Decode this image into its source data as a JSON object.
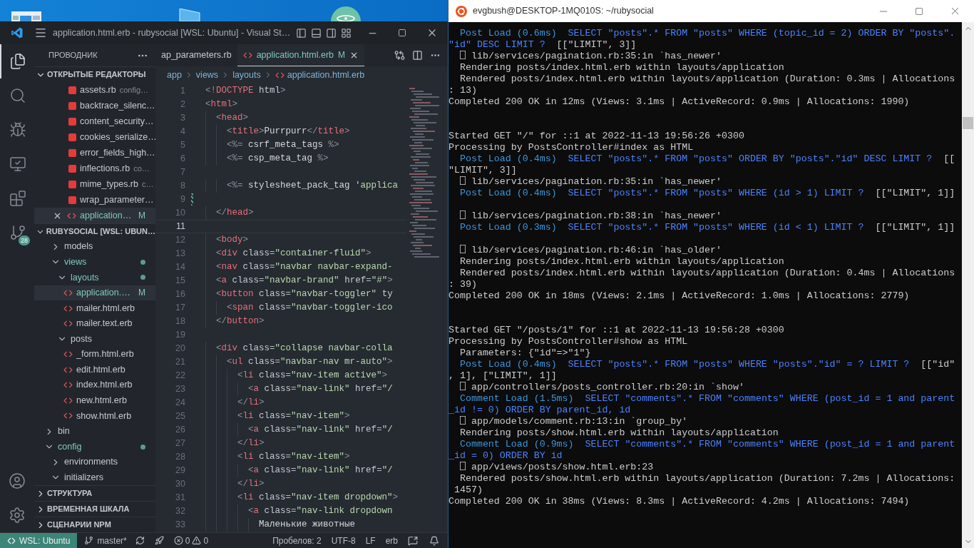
{
  "vscode": {
    "title": "application.html.erb - rubysocial [WSL: Ubuntu] - Visual St…",
    "activity_bar": [
      {
        "kind": "explorer",
        "selected": true
      },
      {
        "kind": "search",
        "selected": false
      },
      {
        "kind": "run",
        "selected": false
      },
      {
        "kind": "remote",
        "selected": false
      },
      {
        "kind": "extensions",
        "selected": false
      },
      {
        "kind": "source_control",
        "selected": false,
        "badge": "28"
      }
    ],
    "explorer": {
      "title": "ПРОВОДНИК",
      "open_editors": {
        "title": "ОТКРЫТЫЕ РЕДАКТОРЫ",
        "expanded": true,
        "items": [
          {
            "kind": "ruby",
            "name": "assets.rb",
            "description": "config…",
            "selected": false
          },
          {
            "kind": "ruby",
            "name": "backtrace_silenc…",
            "selected": false
          },
          {
            "kind": "ruby",
            "name": "content_security…",
            "selected": false
          },
          {
            "kind": "ruby",
            "name": "cookies_serialize…",
            "selected": false
          },
          {
            "kind": "ruby",
            "name": "error_fields_high…",
            "selected": false
          },
          {
            "kind": "ruby",
            "name": "inflections.rb",
            "description": "co…",
            "selected": false
          },
          {
            "kind": "ruby",
            "name": "mime_types.rb",
            "description": "c…",
            "selected": false
          },
          {
            "kind": "ruby",
            "name": "wrap_parameter…",
            "selected": false
          },
          {
            "kind": "html",
            "name": "application…",
            "git": "M",
            "selected": true
          }
        ]
      },
      "project": {
        "title": "RUBYSOCIAL [WSL: UBUN…",
        "expanded": true,
        "tree": [
          {
            "kind": "group",
            "children": [
              {
                "kind": "folder",
                "name": "models",
                "expanded": false,
                "modified": false,
                "selected": false
              },
              {
                "kind": "folder",
                "name": "views",
                "expanded": true,
                "modified": true,
                "selected": false,
                "children": [
                  {
                    "kind": "folder",
                    "name": "layouts",
                    "expanded": true,
                    "modified": true,
                    "selected": false,
                    "children": [
                      {
                        "kind": "html",
                        "name": "application.…",
                        "git": "M",
                        "selected": true
                      },
                      {
                        "kind": "html",
                        "name": "mailer.html.erb",
                        "selected": false
                      },
                      {
                        "kind": "html",
                        "name": "mailer.text.erb",
                        "selected": false
                      }
                    ]
                  },
                  {
                    "kind": "folder",
                    "name": "posts",
                    "expanded": true,
                    "modified": false,
                    "selected": false,
                    "children": [
                      {
                        "kind": "html",
                        "name": "_form.html.erb",
                        "selected": false
                      },
                      {
                        "kind": "html",
                        "name": "edit.html.erb",
                        "selected": false
                      },
                      {
                        "kind": "html",
                        "name": "index.html.erb",
                        "selected": false
                      },
                      {
                        "kind": "html",
                        "name": "new.html.erb",
                        "selected": false
                      },
                      {
                        "kind": "html",
                        "name": "show.html.erb",
                        "selected": false
                      }
                    ]
                  }
                ]
              }
            ]
          },
          {
            "kind": "folder",
            "name": "bin",
            "expanded": false,
            "modified": false,
            "selected": false
          },
          {
            "kind": "folder",
            "name": "config",
            "expanded": true,
            "modified": true,
            "selected": false,
            "children": [
              {
                "kind": "folder",
                "name": "environments",
                "expanded": false,
                "modified": false,
                "selected": false
              },
              {
                "kind": "folder",
                "name": "initializers",
                "expanded": true,
                "modified": false,
                "selected": false
              }
            ]
          }
        ]
      },
      "panels": [
        {
          "title": "СТРУКТУРА",
          "expanded": false
        },
        {
          "title": "ВРЕМЕННАЯ ШКАЛА",
          "expanded": false
        },
        {
          "title": "СЦЕНАРИИ NPM",
          "expanded": false
        }
      ]
    },
    "tabs": [
      {
        "label": "ap_parameters.rb",
        "selected": false
      },
      {
        "label": "application.html.erb",
        "kind": "html",
        "git": "M",
        "selected": true
      }
    ],
    "breadcrumbs": [
      "app",
      "views",
      "layouts",
      "application.html.erb"
    ],
    "lines": [
      {
        "n": "1",
        "code": "<!DOCTYPE html>",
        "current": false,
        "changed": false
      },
      {
        "n": "2",
        "code": "<html>",
        "current": false,
        "changed": false
      },
      {
        "n": "3",
        "code": "  <head>",
        "current": false,
        "changed": false
      },
      {
        "n": "4",
        "code": "    <title>Purrpurr</title>",
        "current": false,
        "changed": false
      },
      {
        "n": "5",
        "code": "    <%= csrf_meta_tags %>",
        "current": false,
        "changed": false
      },
      {
        "n": "6",
        "code": "    <%= csp_meta_tag %>",
        "current": false,
        "changed": false
      },
      {
        "n": "7",
        "current": false,
        "changed": false
      },
      {
        "n": "8",
        "code": "    <%= stylesheet_pack_tag 'applica",
        "current": false,
        "changed": false
      },
      {
        "n": "9",
        "current": false,
        "changed": true
      },
      {
        "n": "10",
        "code": "  </head>",
        "current": false,
        "changed": false
      },
      {
        "n": "11",
        "current": true,
        "changed": false
      },
      {
        "n": "12",
        "code": "  <body>",
        "current": false,
        "changed": false
      },
      {
        "n": "13",
        "code": "  <div class=\"container-fluid\">",
        "current": false,
        "changed": false
      },
      {
        "n": "14",
        "code": "  <nav class=\"navbar navbar-expand-",
        "current": false,
        "changed": false
      },
      {
        "n": "15",
        "code": "  <a class=\"navbar-brand\" href=\"#\">",
        "current": false,
        "changed": false
      },
      {
        "n": "16",
        "code": "  <button class=\"navbar-toggler\" ty",
        "current": false,
        "changed": false
      },
      {
        "n": "17",
        "code": "    <span class=\"navbar-toggler-ico",
        "current": false,
        "changed": false
      },
      {
        "n": "18",
        "code": "  </button>",
        "current": false,
        "changed": false
      },
      {
        "n": "19",
        "current": false,
        "changed": false
      },
      {
        "n": "20",
        "code": "  <div class=\"collapse navbar-colla",
        "current": false,
        "changed": false
      },
      {
        "n": "21",
        "code": "    <ul class=\"navbar-nav mr-auto\">",
        "current": false,
        "changed": false
      },
      {
        "n": "22",
        "code": "      <li class=\"nav-item active\">",
        "current": false,
        "changed": false
      },
      {
        "n": "23",
        "code": "        <a class=\"nav-link\" href=\"/",
        "current": false,
        "changed": false
      },
      {
        "n": "24",
        "code": "      </li>",
        "current": false,
        "changed": false
      },
      {
        "n": "25",
        "code": "      <li class=\"nav-item\">",
        "current": false,
        "changed": false
      },
      {
        "n": "26",
        "code": "        <a class=\"nav-link\" href=\"/",
        "current": false,
        "changed": false
      },
      {
        "n": "27",
        "code": "      </li>",
        "current": false,
        "changed": false
      },
      {
        "n": "28",
        "code": "      <li class=\"nav-item\">",
        "current": false,
        "changed": false
      },
      {
        "n": "29",
        "code": "        <a class=\"nav-link\" href=\"/",
        "current": false,
        "changed": false
      },
      {
        "n": "30",
        "code": "      </li>",
        "current": false,
        "changed": false
      },
      {
        "n": "31",
        "code": "      <li class=\"nav-item dropdown\">",
        "current": false,
        "changed": false
      },
      {
        "n": "32",
        "code": "        <a class=\"nav-link dropdown",
        "current": false,
        "changed": false
      },
      {
        "n": "33",
        "code": "          Маленькие животные",
        "current": false,
        "changed": false
      }
    ],
    "status_bar": {
      "remote": "WSL: Ubuntu",
      "branch": "master*",
      "errors": "0",
      "warnings": "0",
      "right": [
        "Пробелов: 2",
        "UTF-8",
        "LF",
        "erb"
      ]
    }
  },
  "terminal": {
    "title": "evgbush@DESKTOP-1MQ010S: ~/rubysocial",
    "lines": [
      {
        "segments": [
          {
            "kind": "label",
            "text": "  Post Load (0.6ms)"
          },
          {
            "kind": "sql",
            "text": "  SELECT \"posts\".* FROM \"posts\" WHERE (topic_id = 2) ORDER BY \"posts\"."
          }
        ]
      },
      {
        "segments": [
          {
            "kind": "sql",
            "text": "\"id\" DESC LIMIT ?"
          },
          {
            "kind": "text",
            "text": "  [[\"LIMIT\", 3]]"
          }
        ]
      },
      {
        "segments": [
          {
            "kind": "text",
            "text": "  ⎕ lib/services/pagination.rb:35:in `has_newer'"
          }
        ]
      },
      {
        "segments": [
          {
            "kind": "text",
            "text": "  Rendering posts/index.html.erb within layouts/application"
          }
        ]
      },
      {
        "segments": [
          {
            "kind": "text",
            "text": "  Rendered posts/index.html.erb within layouts/application (Duration: 0.3ms | Allocations"
          }
        ]
      },
      {
        "segments": [
          {
            "kind": "text",
            "text": ": 13)"
          }
        ]
      },
      {
        "segments": [
          {
            "kind": "text",
            "text": "Completed 200 OK in 12ms (Views: 3.1ms | ActiveRecord: 0.9ms | Allocations: 1990)"
          }
        ]
      },
      {
        "kind": "blank"
      },
      {
        "kind": "blank"
      },
      {
        "segments": [
          {
            "kind": "text",
            "text": "Started GET \"/\" for ::1 at 2022-11-13 19:56:26 +0300"
          }
        ]
      },
      {
        "segments": [
          {
            "kind": "text",
            "text": "Processing by PostsController#index as HTML"
          }
        ]
      },
      {
        "segments": [
          {
            "kind": "label",
            "text": "  Post Load (0.4ms)"
          },
          {
            "kind": "sql",
            "text": "  SELECT \"posts\".* FROM \"posts\" ORDER BY \"posts\".\"id\" DESC LIMIT ?"
          },
          {
            "kind": "text",
            "text": "  [["
          }
        ]
      },
      {
        "segments": [
          {
            "kind": "text",
            "text": "\"LIMIT\", 3]]"
          }
        ]
      },
      {
        "segments": [
          {
            "kind": "text",
            "text": "  ⎕ lib/services/pagination.rb:35:in `has_newer'"
          }
        ]
      },
      {
        "segments": [
          {
            "kind": "label",
            "text": "  Post Load (0.4ms)"
          },
          {
            "kind": "sql",
            "text": "  SELECT \"posts\".* FROM \"posts\" WHERE (id > 1) LIMIT ?"
          },
          {
            "kind": "text",
            "text": "  [[\"LIMIT\", 1]]"
          }
        ]
      },
      {
        "kind": "blank"
      },
      {
        "segments": [
          {
            "kind": "text",
            "text": "  ⎕ lib/services/pagination.rb:38:in `has_newer'"
          }
        ]
      },
      {
        "segments": [
          {
            "kind": "label",
            "text": "  Post Load (0.3ms)"
          },
          {
            "kind": "sql",
            "text": "  SELECT \"posts\".* FROM \"posts\" WHERE (id < 1) LIMIT ?"
          },
          {
            "kind": "text",
            "text": "  [[\"LIMIT\", 1]]"
          }
        ]
      },
      {
        "kind": "blank"
      },
      {
        "segments": [
          {
            "kind": "text",
            "text": "  ⎕ lib/services/pagination.rb:46:in `has_older'"
          }
        ]
      },
      {
        "segments": [
          {
            "kind": "text",
            "text": "  Rendering posts/index.html.erb within layouts/application"
          }
        ]
      },
      {
        "segments": [
          {
            "kind": "text",
            "text": "  Rendered posts/index.html.erb within layouts/application (Duration: 0.4ms | Allocations"
          }
        ]
      },
      {
        "segments": [
          {
            "kind": "text",
            "text": ": 39)"
          }
        ]
      },
      {
        "segments": [
          {
            "kind": "text",
            "text": "Completed 200 OK in 18ms (Views: 2.1ms | ActiveRecord: 1.0ms | Allocations: 2779)"
          }
        ]
      },
      {
        "kind": "blank"
      },
      {
        "kind": "blank"
      },
      {
        "segments": [
          {
            "kind": "text",
            "text": "Started GET \"/posts/1\" for ::1 at 2022-11-13 19:56:28 +0300"
          }
        ]
      },
      {
        "segments": [
          {
            "kind": "text",
            "text": "Processing by PostsController#show as HTML"
          }
        ]
      },
      {
        "segments": [
          {
            "kind": "text",
            "text": "  Parameters: {\"id\"=>\"1\"}"
          }
        ]
      },
      {
        "segments": [
          {
            "kind": "label",
            "text": "  Post Load (0.4ms)"
          },
          {
            "kind": "sql",
            "text": "  SELECT \"posts\".* FROM \"posts\" WHERE \"posts\".\"id\" = ? LIMIT ?"
          },
          {
            "kind": "text",
            "text": "  [[\"id\""
          }
        ]
      },
      {
        "segments": [
          {
            "kind": "text",
            "text": ", 1], [\"LIMIT\", 1]]"
          }
        ]
      },
      {
        "segments": [
          {
            "kind": "text",
            "text": "  ⎕ app/controllers/posts_controller.rb:20:in `show'"
          }
        ]
      },
      {
        "segments": [
          {
            "kind": "label",
            "text": "  Comment Load (1.5ms)"
          },
          {
            "kind": "sql",
            "text": "  SELECT \"comments\".* FROM \"comments\" WHERE (post_id = 1 and parent"
          }
        ]
      },
      {
        "segments": [
          {
            "kind": "sql",
            "text": "_id != 0) ORDER BY parent_id, id"
          }
        ]
      },
      {
        "segments": [
          {
            "kind": "text",
            "text": "  ⎕ app/models/comment.rb:13:in `group_by'"
          }
        ]
      },
      {
        "segments": [
          {
            "kind": "text",
            "text": "  Rendering posts/show.html.erb within layouts/application"
          }
        ]
      },
      {
        "segments": [
          {
            "kind": "label",
            "text": "  Comment Load (0.9ms)"
          },
          {
            "kind": "sql",
            "text": "  SELECT \"comments\".* FROM \"comments\" WHERE (post_id = 1 and parent"
          }
        ]
      },
      {
        "segments": [
          {
            "kind": "sql",
            "text": "_id = 0) ORDER BY id"
          }
        ]
      },
      {
        "segments": [
          {
            "kind": "text",
            "text": "  ⎕ app/views/posts/show.html.erb:23"
          }
        ]
      },
      {
        "segments": [
          {
            "kind": "text",
            "text": "  Rendered posts/show.html.erb within layouts/application (Duration: 7.2ms | Allocations:"
          }
        ]
      },
      {
        "segments": [
          {
            "kind": "text",
            "text": " 1457)"
          }
        ]
      },
      {
        "segments": [
          {
            "kind": "text",
            "text": "Completed 200 OK in 38ms (Views: 8.3ms | ActiveRecord: 4.2ms | Allocations: 7494)"
          }
        ]
      }
    ]
  }
}
